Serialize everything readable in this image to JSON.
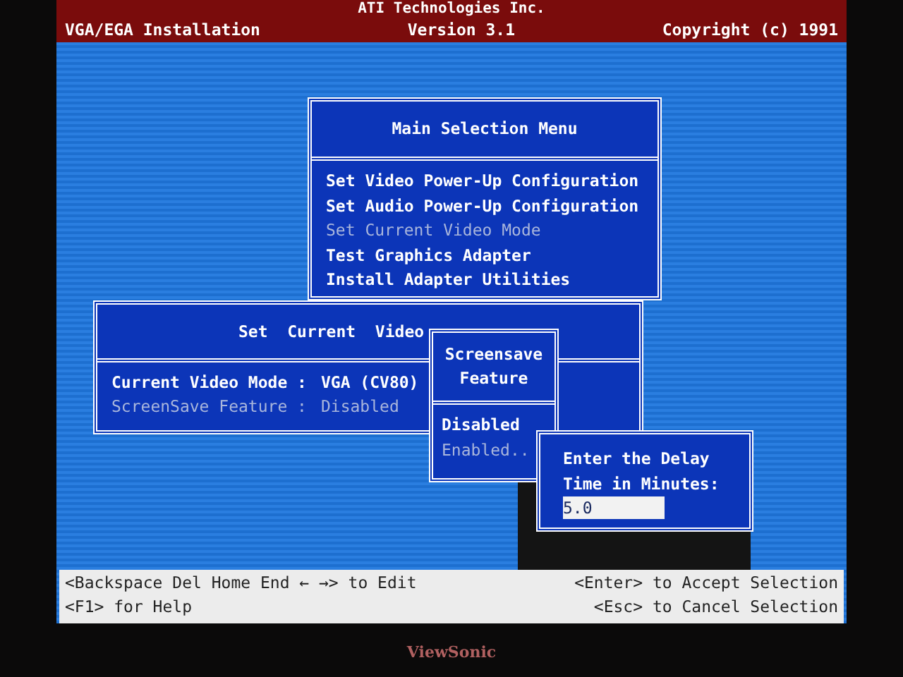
{
  "header": {
    "company": "ATI Technologies Inc.",
    "product": "VGA/EGA  Installation",
    "version": "Version 3.1",
    "copyright": "Copyright (c) 1991"
  },
  "main_menu": {
    "title": "Main Selection Menu",
    "items": [
      {
        "label": "Set Video Power-Up Configuration",
        "disabled": false
      },
      {
        "label": "Set Audio Power-Up Configuration",
        "disabled": false
      },
      {
        "label": "Set Current Video Mode",
        "disabled": true
      },
      {
        "label": "Test Graphics Adapter",
        "disabled": false
      },
      {
        "label": "Install Adapter Utilities",
        "disabled": false
      }
    ]
  },
  "video_window": {
    "title": "Set  Current  Video",
    "fields": [
      {
        "label": "Current Video Mode :",
        "value": "VGA (CV80)",
        "disabled": false
      },
      {
        "label": "ScreenSave Feature :",
        "value": "Disabled",
        "disabled": true
      }
    ]
  },
  "screensave_menu": {
    "title": "Screensave Feature",
    "options": [
      {
        "label": "Disabled",
        "selected": true
      },
      {
        "label": "Enabled..",
        "selected": false
      }
    ]
  },
  "delay_dialog": {
    "prompt": "Enter the Delay Time in Minutes:",
    "value": "5.0"
  },
  "help_bar": {
    "left": [
      "<Backspace Del Home End ← →> to Edit",
      "<F1> for Help"
    ],
    "right": [
      "<Enter> to Accept Selection",
      "<Esc> to Cancel Selection"
    ]
  },
  "monitor": {
    "brand": "ViewSonic"
  }
}
